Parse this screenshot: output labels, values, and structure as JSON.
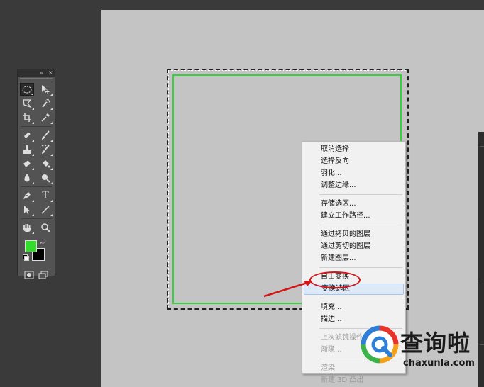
{
  "tools_panel": {
    "collapse_glyph": "«",
    "close_glyph": "×",
    "foreground_color": "#33dd2c",
    "background_color": "#000000",
    "tools": [
      [
        "rectangular-marquee",
        "move"
      ],
      [
        "lasso",
        "quick-selection"
      ],
      [
        "crop",
        "eyedropper"
      ],
      [
        "healing-brush",
        "brush"
      ],
      [
        "clone-stamp",
        "history-brush"
      ],
      [
        "eraser",
        "paint-bucket"
      ],
      [
        "blur",
        "dodge"
      ],
      [
        "pen",
        "type"
      ],
      [
        "path-selection",
        "line"
      ],
      [
        "hand",
        "zoom"
      ]
    ],
    "type_glyph": "T"
  },
  "canvas": {
    "background": "#c4c4c4",
    "shape_stroke_color": "#35d23b"
  },
  "context_menu": {
    "groups": [
      [
        {
          "label": "取消选择",
          "enabled": true
        },
        {
          "label": "选择反向",
          "enabled": true
        },
        {
          "label": "羽化...",
          "enabled": true
        },
        {
          "label": "调整边缘...",
          "enabled": true
        }
      ],
      [
        {
          "label": "存储选区...",
          "enabled": true
        },
        {
          "label": "建立工作路径...",
          "enabled": true
        }
      ],
      [
        {
          "label": "通过拷贝的图层",
          "enabled": true
        },
        {
          "label": "通过剪切的图层",
          "enabled": true
        },
        {
          "label": "新建图层...",
          "enabled": true
        }
      ],
      [
        {
          "label": "自由变换",
          "enabled": true
        },
        {
          "label": "变换选区",
          "enabled": true,
          "highlighted": true
        }
      ],
      [
        {
          "label": "填充...",
          "enabled": true
        },
        {
          "label": "描边...",
          "enabled": true
        }
      ],
      [
        {
          "label": "上次滤镜操作",
          "enabled": false
        },
        {
          "label": "渐隐...",
          "enabled": false
        }
      ],
      [
        {
          "label": "渲染",
          "enabled": false
        },
        {
          "label": "新建 3D 凸出",
          "enabled": false
        }
      ]
    ]
  },
  "annotation": {
    "color": "#d41515"
  },
  "watermark": {
    "title": "查询啦",
    "url": "chaxunla.com",
    "colors": [
      "#e8332a",
      "#f4a21b",
      "#2f7fd8",
      "#3bb24a"
    ]
  }
}
